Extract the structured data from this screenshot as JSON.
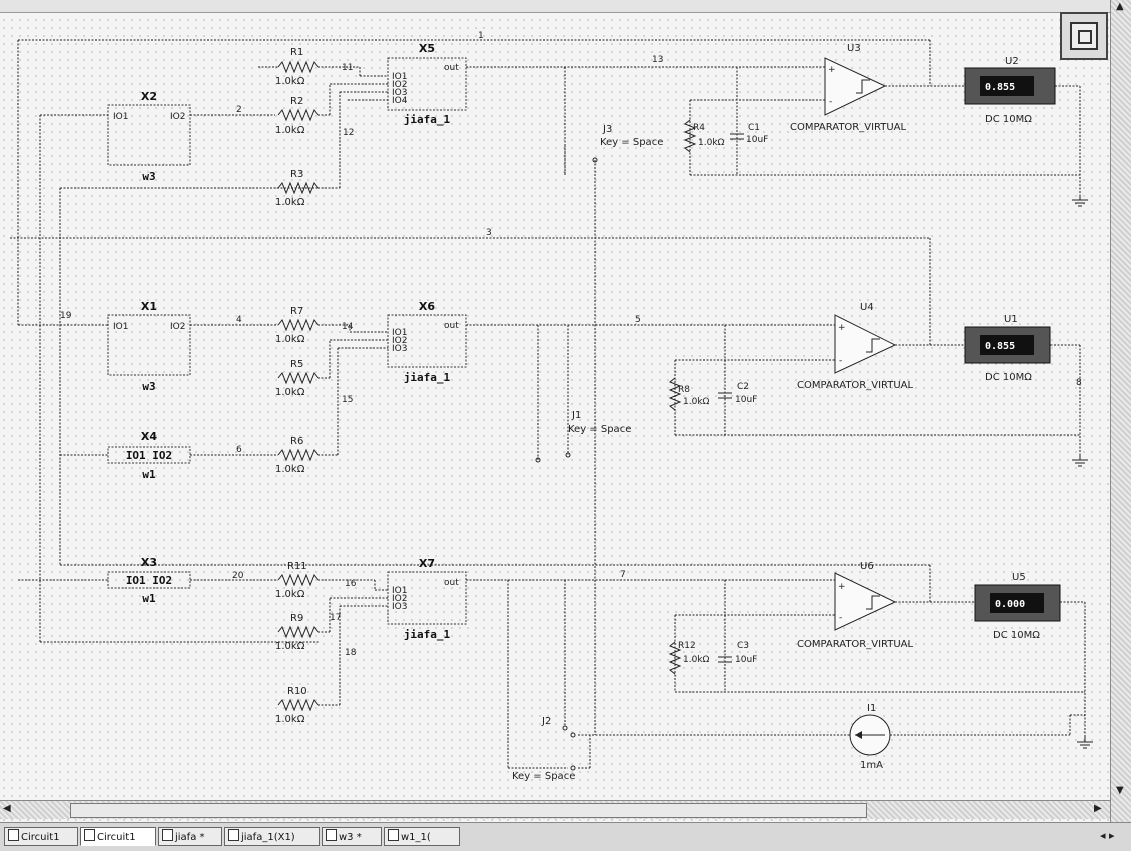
{
  "tabs": [
    {
      "label": "Circuit1",
      "active": false
    },
    {
      "label": "Circuit1",
      "active": true
    },
    {
      "label": "jiafa *",
      "active": false
    },
    {
      "label": "jiafa_1(X1)",
      "active": false
    },
    {
      "label": "w3 *",
      "active": false
    },
    {
      "label": "w1_1(",
      "active": false
    }
  ],
  "tab_nav": "◂ ▸",
  "components": {
    "subX2": {
      "ref": "X2",
      "pin_in": "IO1",
      "pin_out": "IO2",
      "name": "w3"
    },
    "subX1": {
      "ref": "X1",
      "pin_in": "IO1",
      "pin_out": "IO2",
      "name": "w3"
    },
    "subX4": {
      "ref": "X4",
      "pins": "IO1  IO2",
      "name": "w1"
    },
    "subX3": {
      "ref": "X3",
      "pins": "IO1  IO2",
      "name": "w1"
    },
    "subX5": {
      "ref": "X5",
      "pins": [
        "IO1",
        "IO2",
        "IO3",
        "IO4"
      ],
      "out": "out",
      "name": "jiafa_1"
    },
    "subX6": {
      "ref": "X6",
      "pins": [
        "IO1",
        "IO2",
        "IO3"
      ],
      "out": "out",
      "name": "jiafa_1"
    },
    "subX7": {
      "ref": "X7",
      "pins": [
        "IO1",
        "IO2",
        "IO3"
      ],
      "out": "out",
      "name": "jiafa_1"
    },
    "resistors": [
      {
        "ref": "R1",
        "value": "1.0kΩ"
      },
      {
        "ref": "R2",
        "value": "1.0kΩ"
      },
      {
        "ref": "R3",
        "value": "1.0kΩ"
      },
      {
        "ref": "R7",
        "value": "1.0kΩ"
      },
      {
        "ref": "R5",
        "value": "1.0kΩ"
      },
      {
        "ref": "R6",
        "value": "1.0kΩ"
      },
      {
        "ref": "R11",
        "value": "1.0kΩ"
      },
      {
        "ref": "R9",
        "value": "1.0kΩ"
      },
      {
        "ref": "R10",
        "value": "1.0kΩ"
      }
    ],
    "rc": [
      {
        "r_ref": "R4",
        "r_value": "1.0kΩ",
        "c_ref": "C1",
        "c_value": "10uF"
      },
      {
        "r_ref": "R8",
        "r_value": "1.0kΩ",
        "c_ref": "C2",
        "c_value": "10uF"
      },
      {
        "r_ref": "R12",
        "r_value": "1.0kΩ",
        "c_ref": "C3",
        "c_value": "10uF"
      }
    ],
    "comparators": [
      {
        "ref": "U3",
        "name": "COMPARATOR_VIRTUAL"
      },
      {
        "ref": "U4",
        "name": "COMPARATOR_VIRTUAL"
      },
      {
        "ref": "U6",
        "name": "COMPARATOR_VIRTUAL"
      }
    ],
    "meters": [
      {
        "ref": "U2",
        "reading": "0.855",
        "mode": "DC  10MΩ"
      },
      {
        "ref": "U1",
        "reading": "0.855",
        "mode": "DC  10MΩ"
      },
      {
        "ref": "U5",
        "reading": "0.000",
        "mode": "DC  10MΩ"
      }
    ],
    "switches": [
      {
        "ref": "J3",
        "key": "Key = Space"
      },
      {
        "ref": "J1",
        "key": "Key = Space"
      },
      {
        "ref": "J2",
        "key": "Key = Space"
      }
    ],
    "source": {
      "ref": "I1",
      "value": "1mA"
    },
    "nets": {
      "n1": "1",
      "n2": "2",
      "n3": "3",
      "n4": "4",
      "n5": "5",
      "n6": "6",
      "n7": "7",
      "n8": "8",
      "n11": "11",
      "n12": "12",
      "n13": "13",
      "n14": "14",
      "n15": "15",
      "n16": "16",
      "n17": "17",
      "n18": "18",
      "n19": "19",
      "n20": "20"
    }
  }
}
